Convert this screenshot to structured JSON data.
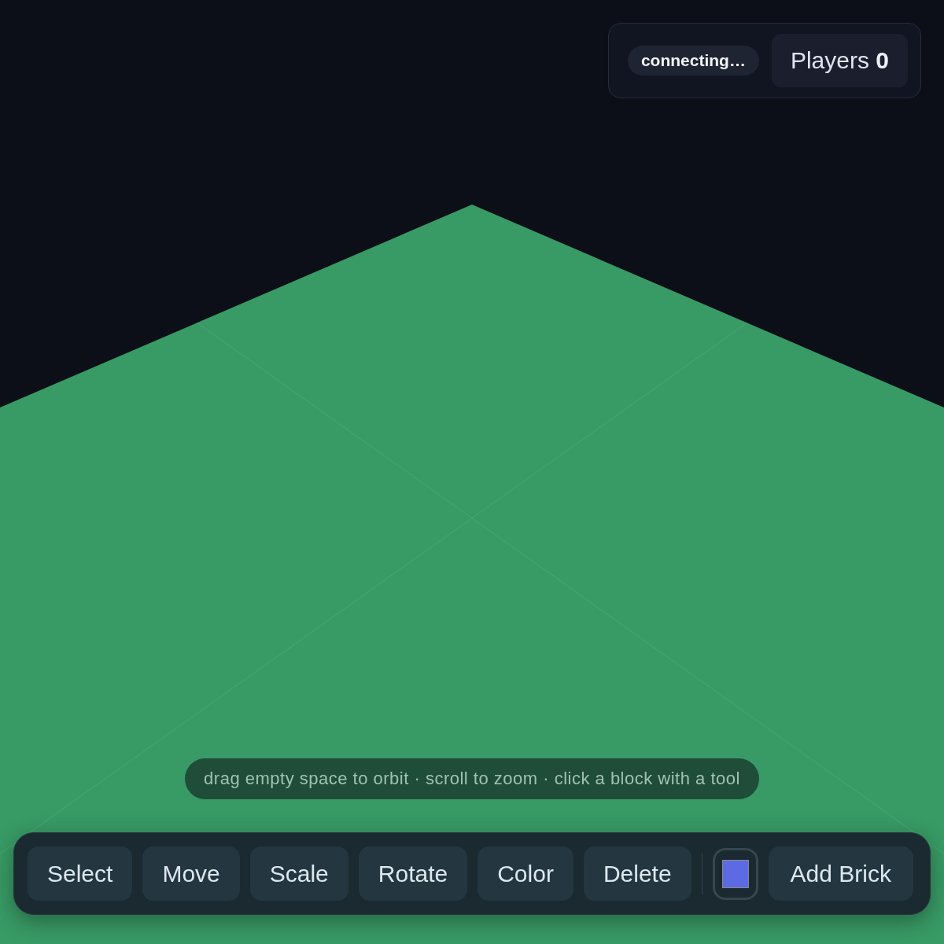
{
  "status": {
    "connection": "connecting…",
    "players": "Players **0**"
  },
  "hint": "drag empty space to orbit · scroll to zoom · click a block with a tool",
  "toolbar": {
    "tools": [
      {
        "label": "Select",
        "selected": false
      },
      {
        "label": "Move",
        "selected": false
      },
      {
        "label": "Scale",
        "selected": false
      },
      {
        "label": "Rotate",
        "selected": false
      },
      {
        "label": "Color",
        "selected": false
      },
      {
        "label": "Delete",
        "selected": false
      }
    ],
    "color_swatch": {
      "color": "#5c6ae4"
    },
    "add_button": "Add Brick"
  }
}
